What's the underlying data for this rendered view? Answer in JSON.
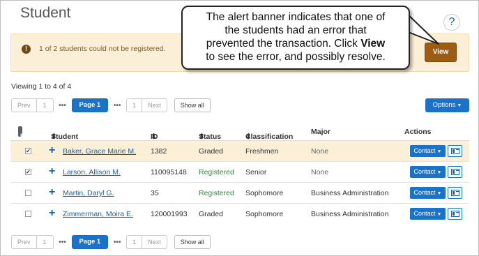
{
  "page": {
    "title": "Student",
    "help_glyph": "?"
  },
  "alert": {
    "message": "1 of 2 students could not be registered.",
    "icon": "exclamation-icon",
    "view_label": "View"
  },
  "callout": {
    "line1": "The alert banner indicates that one of",
    "line2": "the students had an error that",
    "line3_pre": "prevented the transaction. Click ",
    "line3_bold": "View",
    "line4": "to see the error, and possibly resolve."
  },
  "viewing_text": "Viewing 1 to 4 of 4",
  "pager": {
    "prev": "Prev",
    "first": "1",
    "dots": "•••",
    "current": "Page 1",
    "last": "1",
    "next": "Next",
    "show_all": "Show all"
  },
  "options_label": "Options",
  "table": {
    "headers": {
      "all": "All",
      "student": "Student",
      "id": "ID",
      "status": "Status",
      "classification": "Classification",
      "major": "Major",
      "actions": "Actions"
    },
    "sort_glyph": "⬍",
    "contact_label": "Contact",
    "rows": [
      {
        "checked": true,
        "name": "Baker, Grace Marie M.",
        "id": "1382",
        "status": "Graded",
        "classification": "Freshmen",
        "major": "None"
      },
      {
        "checked": true,
        "name": "Larson, Allison M.",
        "id": "110095148",
        "status": "Registered",
        "classification": "Senior",
        "major": "None"
      },
      {
        "checked": false,
        "name": "Martin, Daryl G.",
        "id": "35",
        "status": "Registered",
        "classification": "Sophomore",
        "major": "Business Administration"
      },
      {
        "checked": false,
        "name": "Zimmerman, Moira E.",
        "id": "120001993",
        "status": "Graded",
        "classification": "Sophomore",
        "major": "Business Administration"
      }
    ]
  },
  "colors": {
    "accent": "#1a73c9",
    "alert_bg": "#fcefd7",
    "view_btn": "#9c5d12",
    "registered": "#2e8b3d"
  }
}
